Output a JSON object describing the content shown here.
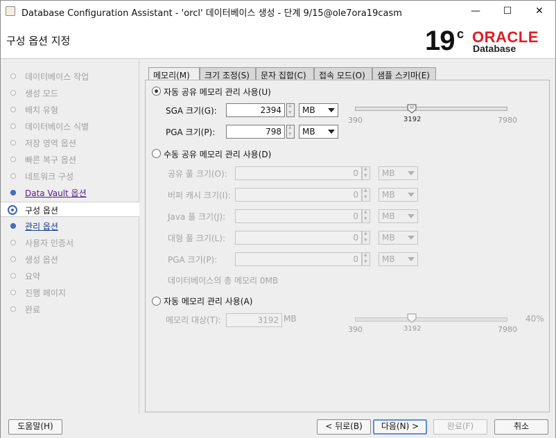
{
  "window": {
    "title": "Database Configuration Assistant - 'orcl' 데이터베이스 생성 - 단계 9/15@ole7ora19casm",
    "minimize": "—",
    "maximize": "☐",
    "close": "✕"
  },
  "header": {
    "page_title": "구성 옵션 지정",
    "logo_version": "19",
    "logo_suffix": "c",
    "logo_brand": "ORACLE",
    "logo_product": "Database"
  },
  "steps": [
    {
      "label": "데이터베이스 작업",
      "state": "done"
    },
    {
      "label": "생성 모드",
      "state": "done"
    },
    {
      "label": "배치 유형",
      "state": "done"
    },
    {
      "label": "데이터베이스 식별",
      "state": "done"
    },
    {
      "label": "저장 영역 옵션",
      "state": "done"
    },
    {
      "label": "빠른 복구 옵션",
      "state": "done"
    },
    {
      "label": "네트워크 구성",
      "state": "done"
    },
    {
      "label": "Data Vault 옵션",
      "state": "link"
    },
    {
      "label": "구성 옵션",
      "state": "current"
    },
    {
      "label": "관리 옵션",
      "state": "link"
    },
    {
      "label": "사용자 인증서",
      "state": "pending"
    },
    {
      "label": "생성 옵션",
      "state": "pending"
    },
    {
      "label": "요약",
      "state": "pending"
    },
    {
      "label": "진행 페이지",
      "state": "pending"
    },
    {
      "label": "완료",
      "state": "pending"
    }
  ],
  "tabs": [
    "메모리(M)",
    "크기 조정(S)",
    "문자 집합(C)",
    "접속 모드(O)",
    "샘플 스키마(E)"
  ],
  "memory": {
    "asmm": {
      "label": "자동 공유 메모리 관리 사용(U)",
      "selected": true,
      "sga_label": "SGA 크기(G):",
      "sga_value": "2394",
      "sga_unit": "MB",
      "pga_label": "PGA 크기(P):",
      "pga_value": "798",
      "pga_unit": "MB",
      "slider_min": "390",
      "slider_value": "3192",
      "slider_max": "7980"
    },
    "manual": {
      "label": "수동 공유 메모리 관리 사용(D)",
      "selected": false,
      "fields": [
        {
          "label": "공유 풀 크기(O):",
          "value": "0",
          "unit": "MB"
        },
        {
          "label": "버퍼 캐시 크기(I):",
          "value": "0",
          "unit": "MB"
        },
        {
          "label": "Java 풀 크기(J):",
          "value": "0",
          "unit": "MB"
        },
        {
          "label": "대형 풀 크기(L):",
          "value": "0",
          "unit": "MB"
        },
        {
          "label": "PGA 크기(P):",
          "value": "0",
          "unit": "MB"
        }
      ],
      "total": "데이터베이스의 총 메모리 0MB"
    },
    "amm": {
      "label": "자동 메모리 관리 사용(A)",
      "selected": false,
      "target_label": "메모리 대상(T):",
      "target_value": "3192",
      "target_unit": "MB",
      "slider_min": "390",
      "slider_value": "3192",
      "slider_max": "7980",
      "percent": "40%"
    }
  },
  "buttons": {
    "help": "도움말(H)",
    "back": "< 뒤로(B)",
    "next": "다음(N) >",
    "finish": "완료(F)",
    "cancel": "취소"
  },
  "colors": {
    "oracle_red": "#e31b23",
    "link_purple": "#551a8b",
    "step_blue": "#3b62b8",
    "default_button_border": "#5b8fd8"
  }
}
